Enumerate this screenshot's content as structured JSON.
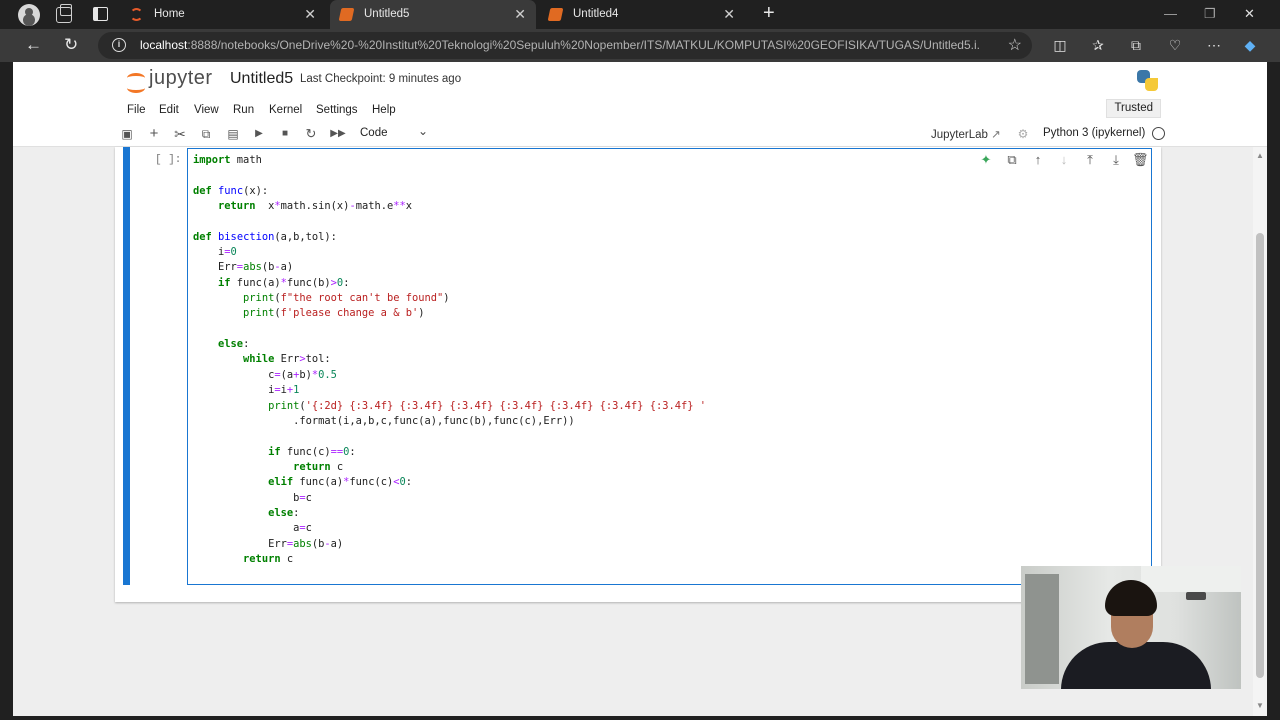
{
  "browser": {
    "tabs": [
      {
        "title": "Home",
        "favicon": "jupyter-home-icon"
      },
      {
        "title": "Untitled5",
        "favicon": "notebook-icon",
        "active": true
      },
      {
        "title": "Untitled4",
        "favicon": "notebook-icon"
      }
    ],
    "url_host": "localhost",
    "url_path": ":8888/notebooks/OneDrive%20-%20Institut%20Teknologi%20Sepuluh%20Nopember/ITS/MATKUL/KOMPUTASI%20GEOFISIKA/TUGAS/Untitled5.i..."
  },
  "jupyter": {
    "logo_text": "jupyter",
    "notebook_name": "Untitled5",
    "checkpoint": "Last Checkpoint: 9 minutes ago",
    "menu": [
      "File",
      "Edit",
      "View",
      "Run",
      "Kernel",
      "Settings",
      "Help"
    ],
    "trusted_label": "Trusted",
    "cell_type": "Code",
    "jupyterlab_link": "JupyterLab",
    "kernel_name": "Python 3 (ipykernel)"
  },
  "cell": {
    "prompt": "[ ]:",
    "source_lines": [
      "import math",
      "",
      "def func(x):",
      "    return  x*math.sin(x)-math.e**x",
      "",
      "def bisection(a,b,tol):",
      "    i=0",
      "    Err=abs(b-a)",
      "    if func(a)*func(b)>0:",
      "        print(f\"the root can't be found\")",
      "        print(f'please change a & b')",
      "",
      "    else:",
      "        while Err>tol:",
      "            c=(a+b)*0.5",
      "            i=i+1",
      "            print('{:2d} {:3.4f} {:3.4f} {:3.4f} {:3.4f} {:3.4f} {:3.4f} {:3.4f} '",
      "                .format(i,a,b,c,func(a),func(b),func(c),Err))",
      "",
      "            if func(c)==0:",
      "                return c",
      "            elif func(a)*func(c)<0:",
      "                b=c",
      "            else:",
      "                a=c",
      "            Err=abs(b-a)",
      "        return c"
    ]
  },
  "colors": {
    "accent": "#1976d2",
    "jupyter_orange": "#f37726",
    "keyword": "#008000",
    "number": "#098658",
    "string": "#ba2121"
  }
}
